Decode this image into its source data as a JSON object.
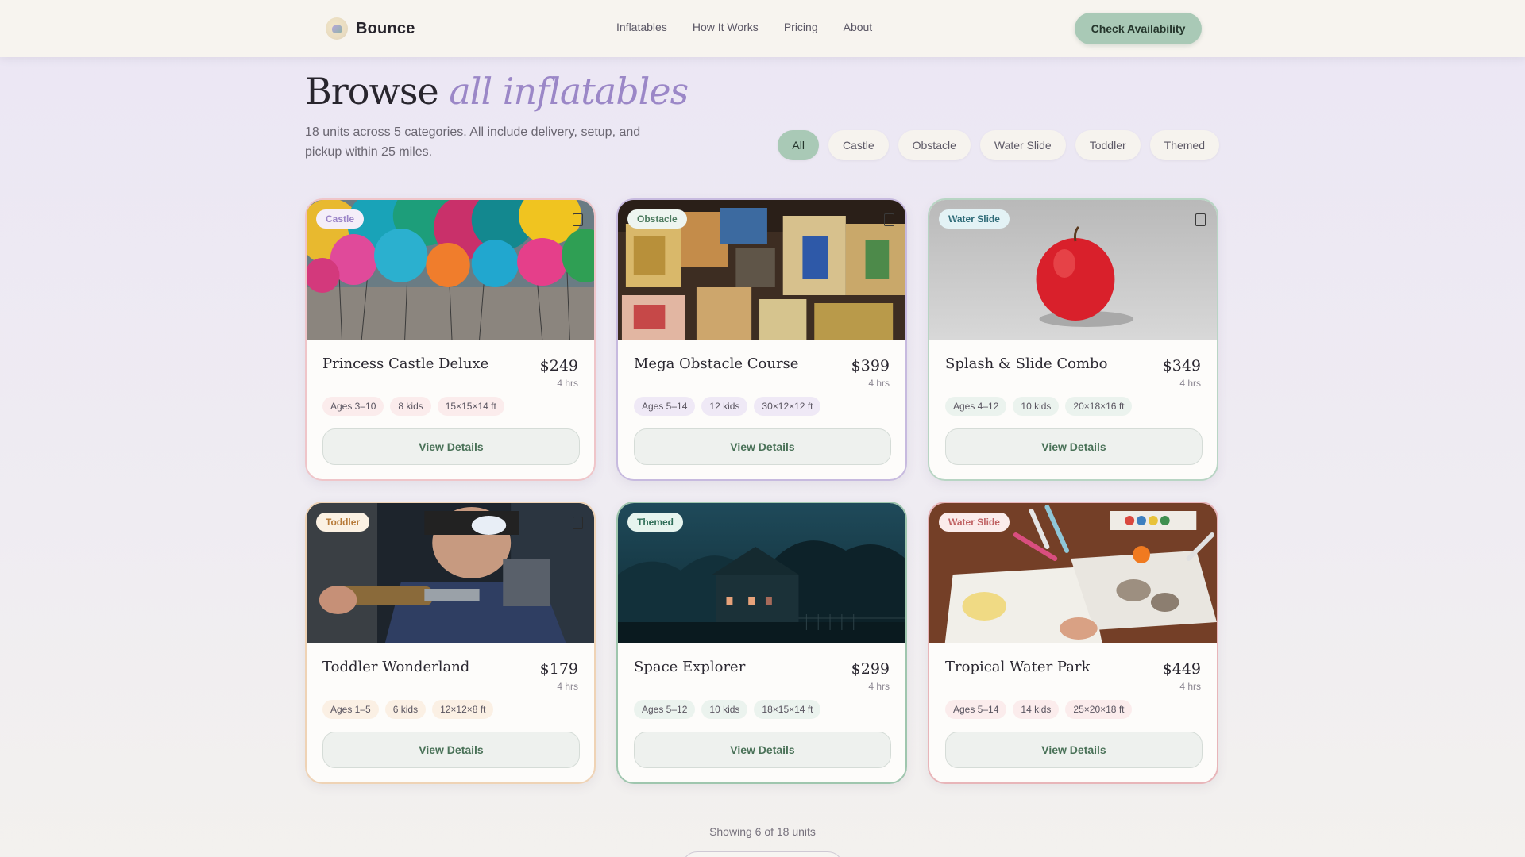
{
  "brand": {
    "name": "Bounce",
    "logo_icon": "balloon-logo-icon"
  },
  "nav": {
    "items": [
      "Inflatables",
      "How It Works",
      "Pricing",
      "About"
    ],
    "cta_label": "Check Availability"
  },
  "hero": {
    "title_plain": "Browse",
    "title_accent": "all inflatables",
    "subtitle": "18 units across 5 categories. All include delivery, setup, and pickup within 25 miles."
  },
  "filters": [
    "All",
    "Castle",
    "Obstacle",
    "Water Slide",
    "Toddler",
    "Themed"
  ],
  "active_filter": "All",
  "cards": [
    {
      "category": "Castle",
      "name": "Princess Castle Deluxe",
      "price": "$249",
      "duration": "4 hrs",
      "tags": [
        "Ages 3–10",
        "8 kids",
        "15×15×14 ft"
      ],
      "button": "View Details",
      "image": "colorful balloons"
    },
    {
      "category": "Obstacle",
      "name": "Mega Obstacle Course",
      "price": "$399",
      "duration": "4 hrs",
      "tags": [
        "Ages 5–14",
        "12 kids",
        "30×12×12 ft"
      ],
      "button": "View Details",
      "image": "wooden alphabet blocks"
    },
    {
      "category": "Water Slide",
      "name": "Splash & Slide Combo",
      "price": "$349",
      "duration": "4 hrs",
      "tags": [
        "Ages 4–12",
        "10 kids",
        "20×18×16 ft"
      ],
      "button": "View Details",
      "image": "red apple on grey"
    },
    {
      "category": "Toddler",
      "name": "Toddler Wonderland",
      "price": "$179",
      "duration": "4 hrs",
      "tags": [
        "Ages 1–5",
        "6 kids",
        "12×12×8 ft"
      ],
      "button": "View Details",
      "image": "man at lathe"
    },
    {
      "category": "Themed",
      "name": "Space Explorer",
      "price": "$299",
      "duration": "4 hrs",
      "tags": [
        "Ages 5–12",
        "10 kids",
        "18×15×14 ft"
      ],
      "button": "View Details",
      "image": "dark house at night"
    },
    {
      "category": "Water Slide",
      "name": "Tropical Water Park",
      "price": "$449",
      "duration": "4 hrs",
      "tags": [
        "Ages 5–14",
        "14 kids",
        "25×20×18 ft"
      ],
      "button": "View Details",
      "image": "art supplies on table"
    }
  ],
  "footer": {
    "showing": "Showing 6 of 18 units"
  },
  "colors": {
    "accent_lavender": "#9b87c7",
    "accent_mint": "#a9c9b6"
  }
}
